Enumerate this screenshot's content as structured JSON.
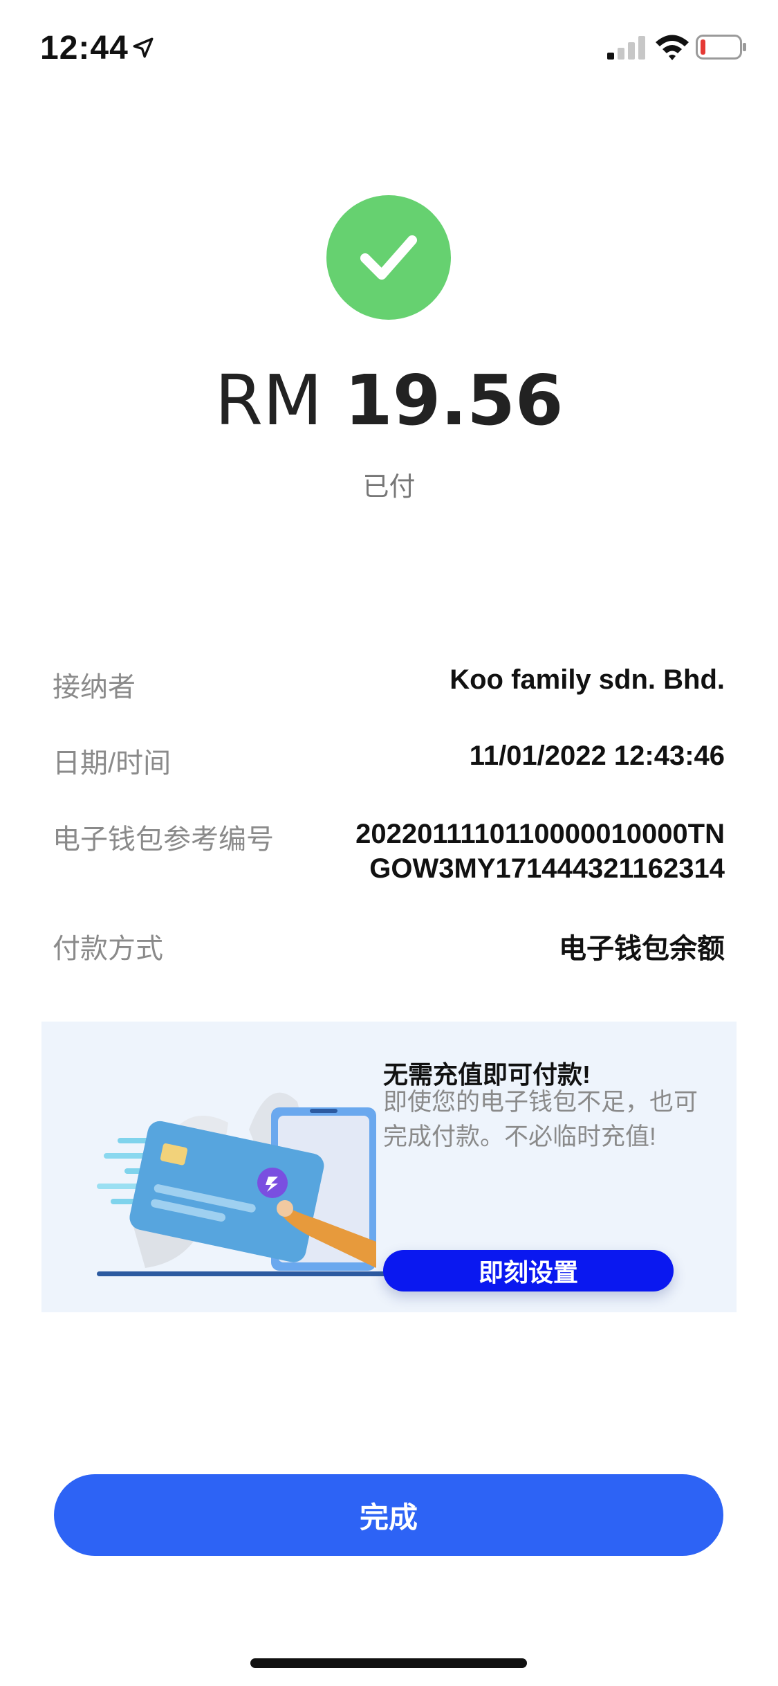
{
  "status_bar": {
    "time": "12:44",
    "icons": [
      "location-arrow-icon",
      "cellular-signal-icon",
      "wifi-icon",
      "battery-low-icon"
    ]
  },
  "payment": {
    "status_icon": "check-circle-icon",
    "currency": "RM",
    "amount": "19.56",
    "status": "已付"
  },
  "details": {
    "recipient_label": "接纳者",
    "recipient_value": "Koo family sdn. Bhd.",
    "datetime_label": "日期/时间",
    "datetime_value": "11/01/2022 12:43:46",
    "reference_label": "电子钱包参考编号",
    "reference_value": "2022011110110000010000TN\nGOW3MY171444321162314",
    "method_label": "付款方式",
    "method_value": "电子钱包余额"
  },
  "promo": {
    "title": "无需充值即可付款!",
    "description": "即使您的电子钱包不足，也可完成付款。不必临时充值!",
    "button_label": "即刻设置",
    "illustration": "card-payment-illustration"
  },
  "actions": {
    "done_label": "完成"
  },
  "colors": {
    "success_green": "#66d170",
    "primary_blue": "#2d63f5",
    "promo_button_blue": "#0a18f0",
    "promo_bg": "#eef4fc",
    "battery_red": "#e53935"
  }
}
